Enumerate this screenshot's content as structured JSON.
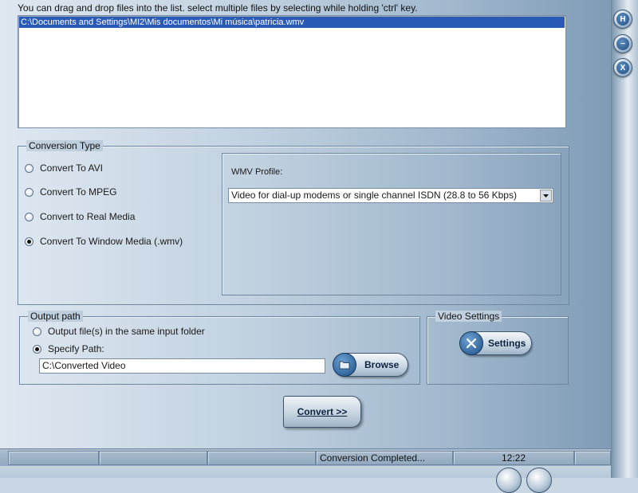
{
  "window_buttons": {
    "help": "H",
    "minimize": "−",
    "close": "X"
  },
  "instructions": "You can drag and drop files into the list. select multiple files by selecting while holding 'ctrl' key.",
  "file_list": [
    "C:\\Documents and Settings\\MI2\\Mis documentos\\Mi música\\patricia.wmv"
  ],
  "conversion_type": {
    "legend": "Conversion Type",
    "options": [
      {
        "label": "Convert To AVI",
        "selected": false
      },
      {
        "label": "Convert To MPEG",
        "selected": false
      },
      {
        "label": "Convert to Real Media",
        "selected": false
      },
      {
        "label": "Convert To Window Media (.wmv)",
        "selected": true
      }
    ],
    "profile_label": "WMV Profile:",
    "profile_value": "Video for dial-up modems or single channel ISDN (28.8 to 56 Kbps)"
  },
  "output_path": {
    "legend": "Output path",
    "option_same_folder": "Output file(s) in the same input folder",
    "option_specify": "Specify Path:",
    "selected": "specify",
    "path_value": "C:\\Converted Video",
    "browse_label": "Browse"
  },
  "video_settings": {
    "legend": "Video Settings",
    "settings_label": "Settings"
  },
  "convert_label": "Convert >>",
  "status_bar": {
    "status": "Conversion Completed...",
    "time": "12:22"
  },
  "colors": {
    "selection": "#2a5ab5",
    "accent": "#1f4c7e"
  }
}
